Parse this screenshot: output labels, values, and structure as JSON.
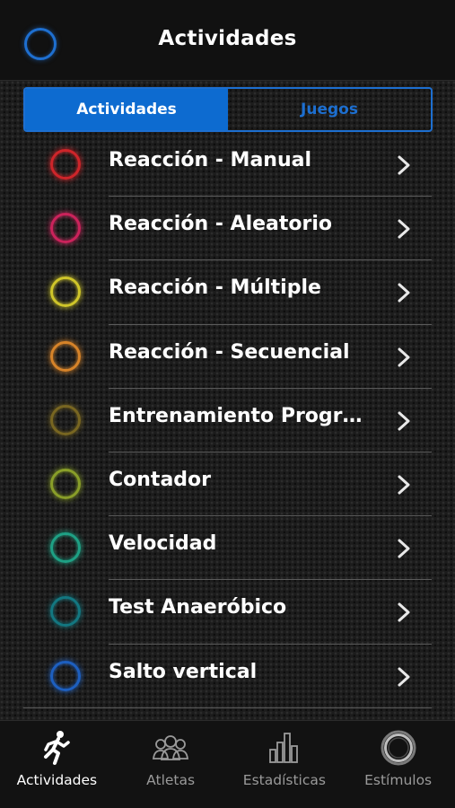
{
  "header": {
    "title": "Actividades"
  },
  "segments": {
    "active": "Actividades",
    "inactive": "Juegos"
  },
  "list": {
    "items": [
      {
        "label": "Reacción - Manual",
        "color": "#d8262b"
      },
      {
        "label": "Reacción - Aleatorio",
        "color": "#d4245f"
      },
      {
        "label": "Reacción - Múltiple",
        "color": "#d9cf2b"
      },
      {
        "label": "Reacción - Secuencial",
        "color": "#e0892a"
      },
      {
        "label": "Entrenamiento Progra…",
        "color": "#7d6a22"
      },
      {
        "label": "Contador",
        "color": "#8fa52a"
      },
      {
        "label": "Velocidad",
        "color": "#1fa88a"
      },
      {
        "label": "Test Anaeróbico",
        "color": "#137c86"
      },
      {
        "label": "Salto vertical",
        "color": "#1e63c8"
      }
    ]
  },
  "tabbar": {
    "tabs": [
      {
        "label": "Actividades",
        "icon": "runner-icon"
      },
      {
        "label": "Atletas",
        "icon": "athletes-icon"
      },
      {
        "label": "Estadísticas",
        "icon": "bar-chart-icon"
      },
      {
        "label": "Estímulos",
        "icon": "ring-icon"
      }
    ]
  }
}
